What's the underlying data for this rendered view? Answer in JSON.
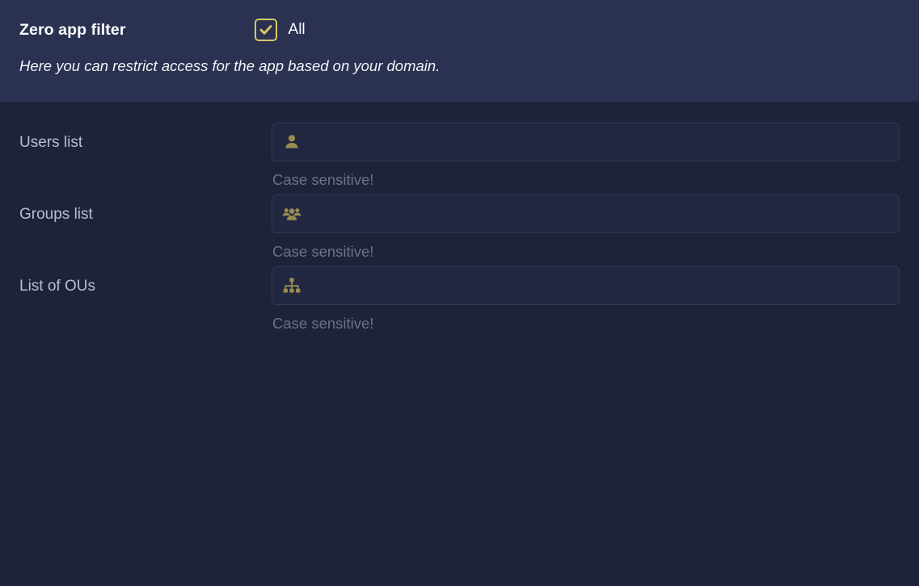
{
  "header": {
    "title": "Zero app filter",
    "filter_checkbox": {
      "label": "All",
      "checked": true,
      "icon": "check-icon"
    },
    "description": "Here you can restrict access for the app based on your domain.",
    "background_color": "#2b3150",
    "accent_color": "#d6c869"
  },
  "form": {
    "rows": [
      {
        "label": "Users list",
        "icon": "person-icon",
        "value": "",
        "placeholder": "",
        "hint": "Case sensitive!"
      },
      {
        "label": "Groups list",
        "icon": "groups-icon",
        "value": "",
        "placeholder": "",
        "hint": "Case sensitive!"
      },
      {
        "label": "List of OUs",
        "icon": "account-tree-icon",
        "value": "",
        "placeholder": "",
        "hint": "Case sensitive!"
      }
    ]
  },
  "theme": {
    "page_background": "#1e2339",
    "input_background": "#212741",
    "input_border": "#323a57",
    "icon_color": "#9a8c4e",
    "label_color": "#b9bfd1",
    "hint_color": "#6b7289"
  }
}
